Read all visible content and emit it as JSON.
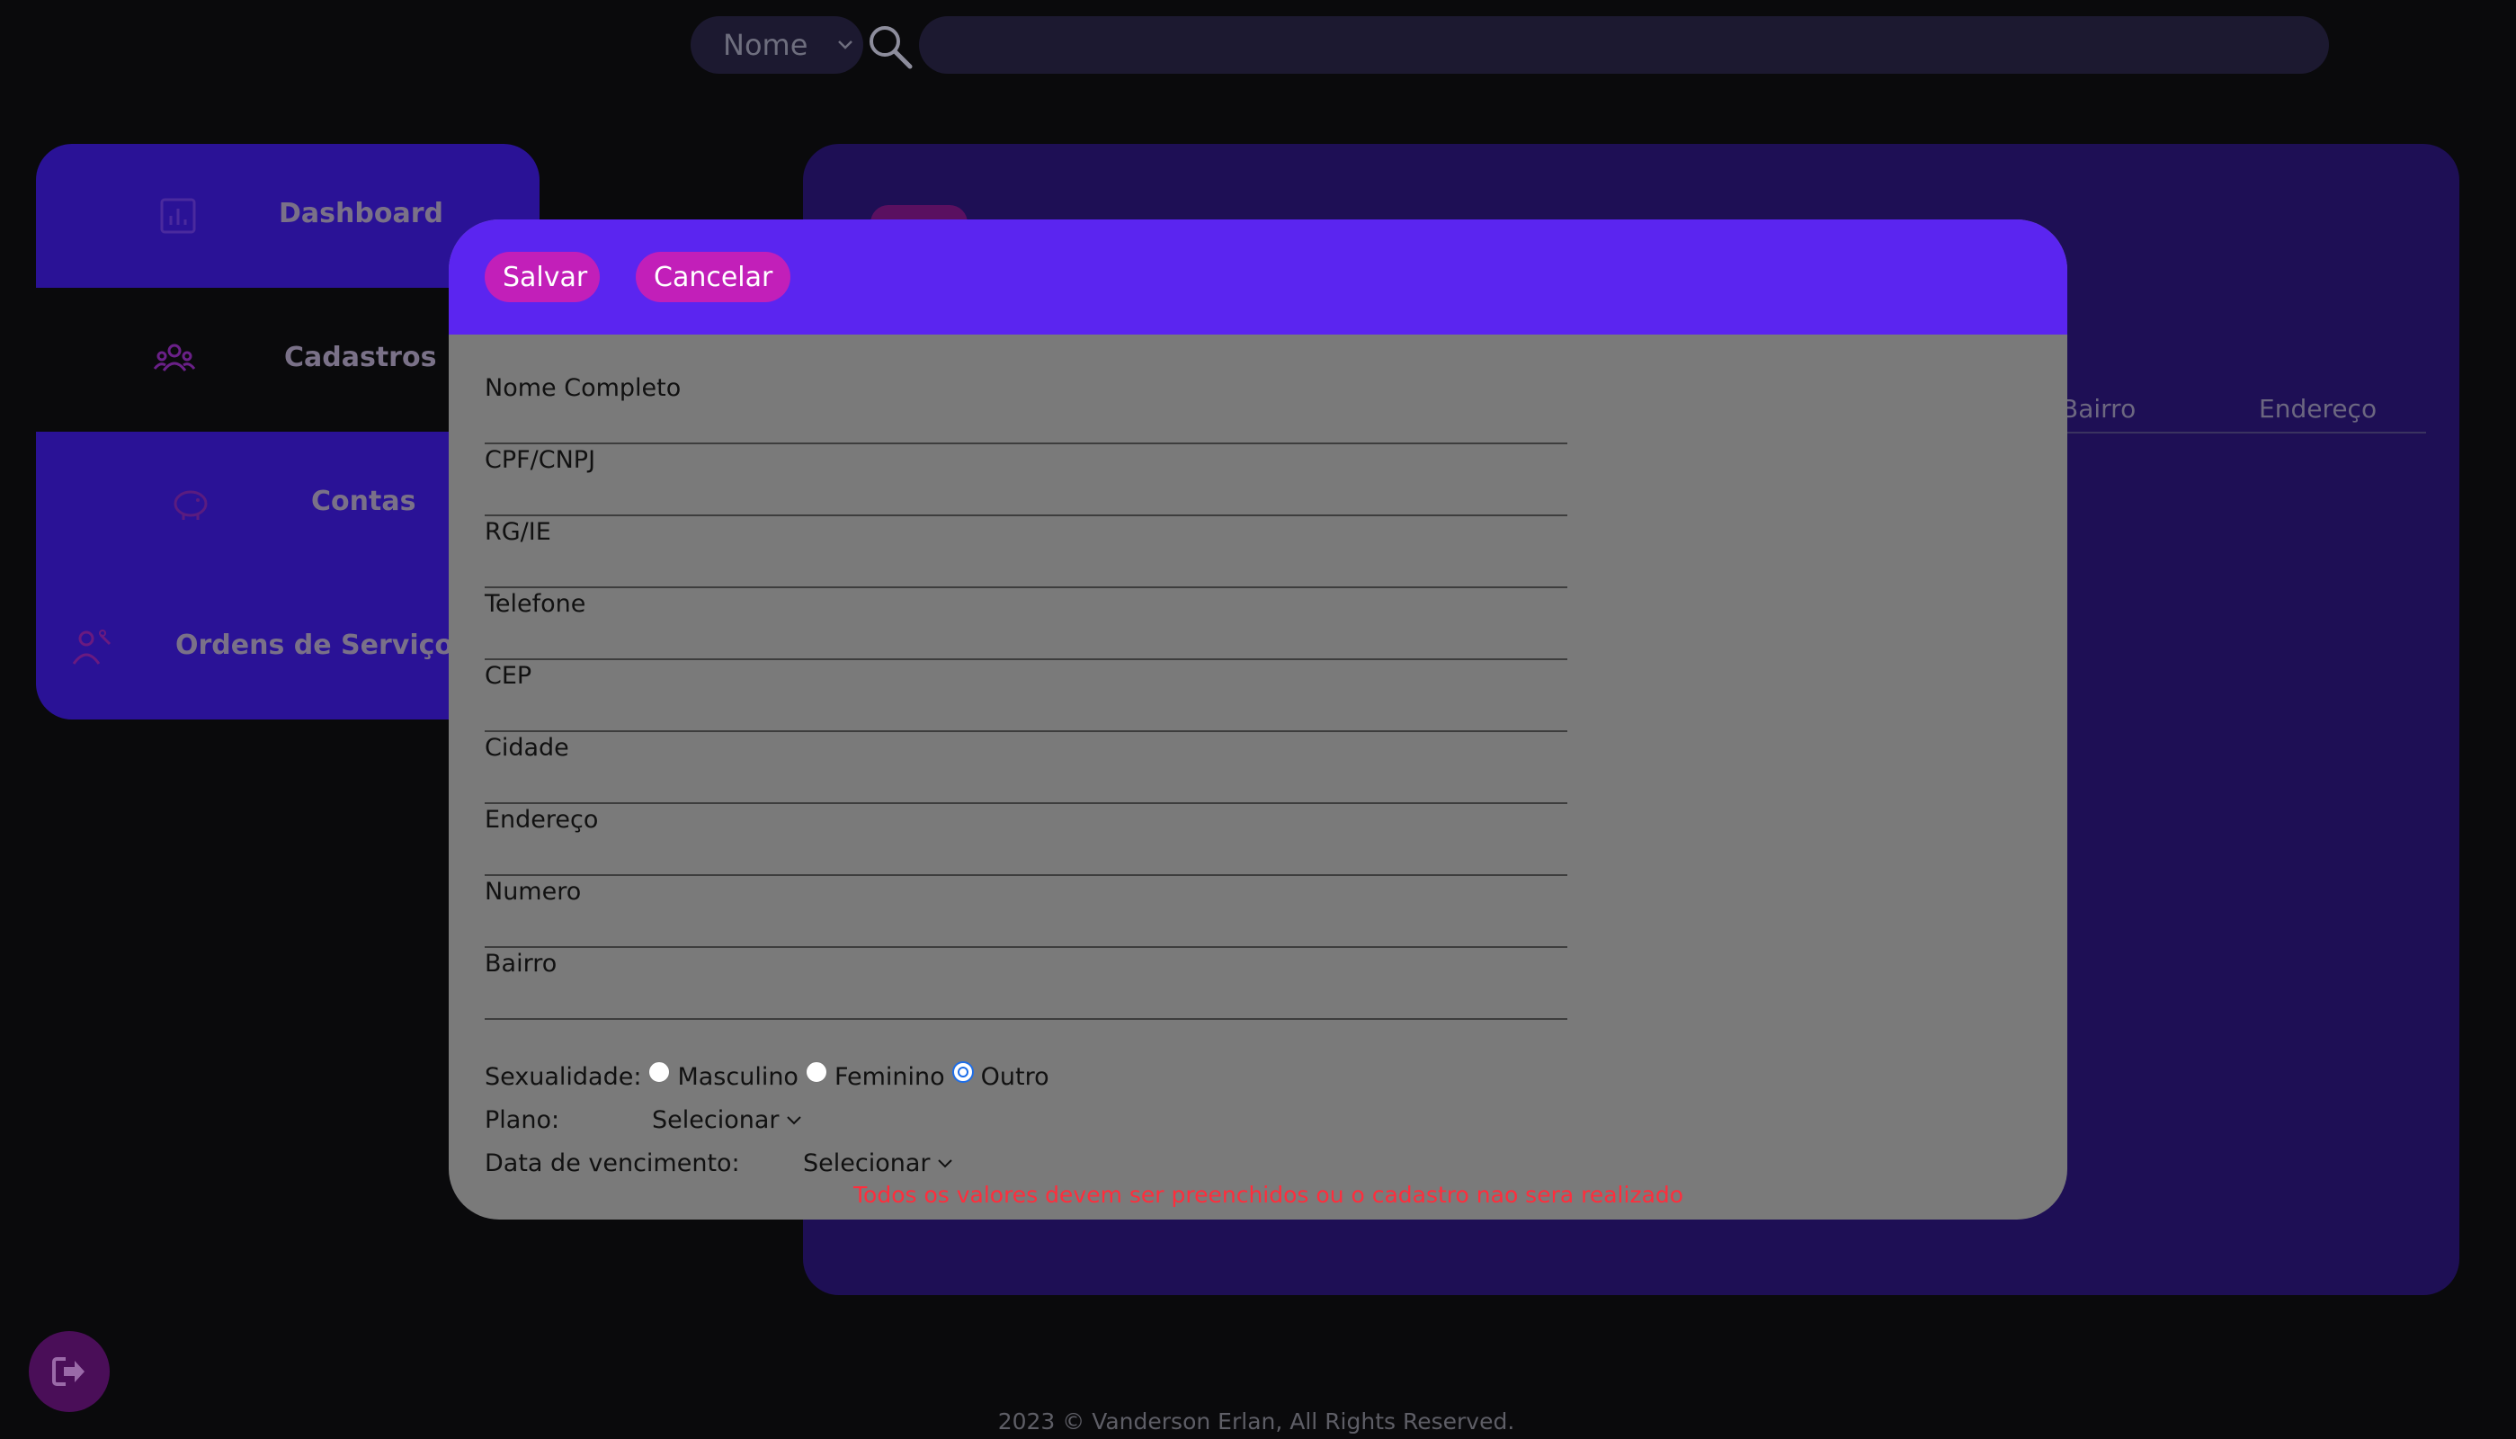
{
  "search": {
    "filter_selected": "Nome",
    "placeholder": ""
  },
  "sidebar": {
    "items": [
      {
        "label": "Dashboard",
        "icon": "chart-icon"
      },
      {
        "label": "Cadastros",
        "icon": "users-icon"
      },
      {
        "label": "Contas",
        "icon": "piggy-bank-icon"
      },
      {
        "label": "Ordens de Serviço",
        "icon": "technician-icon"
      }
    ]
  },
  "table": {
    "columns": [
      "Bairro",
      "Endereço"
    ]
  },
  "modal": {
    "save_label": "Salvar",
    "cancel_label": "Cancelar",
    "fields": [
      {
        "label": "Nome Completo",
        "value": ""
      },
      {
        "label": "CPF/CNPJ",
        "value": ""
      },
      {
        "label": "RG/IE",
        "value": ""
      },
      {
        "label": "Telefone",
        "value": ""
      },
      {
        "label": "CEP",
        "value": ""
      },
      {
        "label": "Cidade",
        "value": ""
      },
      {
        "label": "Endereço",
        "value": ""
      },
      {
        "label": "Numero",
        "value": ""
      },
      {
        "label": "Bairro",
        "value": ""
      }
    ],
    "sexuality": {
      "label": "Sexualidade:",
      "options": [
        "Masculino",
        "Feminino",
        "Outro"
      ],
      "selected": "Outro"
    },
    "plan": {
      "label": "Plano:",
      "selected": "Selecionar"
    },
    "due_date": {
      "label": "Data de vencimento:",
      "selected": "Selecionar"
    },
    "warning": "Todos os valores devem ser preenchidos ou o cadastro nao sera realizado"
  },
  "footer": {
    "text": "2023 © Vanderson Erlan, All Rights Reserved."
  },
  "colors": {
    "background": "#0a0a0c",
    "sidebar": "#2a1296",
    "panel": "#1e0f55",
    "modal_header": "#5b25f0",
    "button": "#c21fb9",
    "warning": "#ff2d3c",
    "radio_checked": "#1e6ee8"
  }
}
